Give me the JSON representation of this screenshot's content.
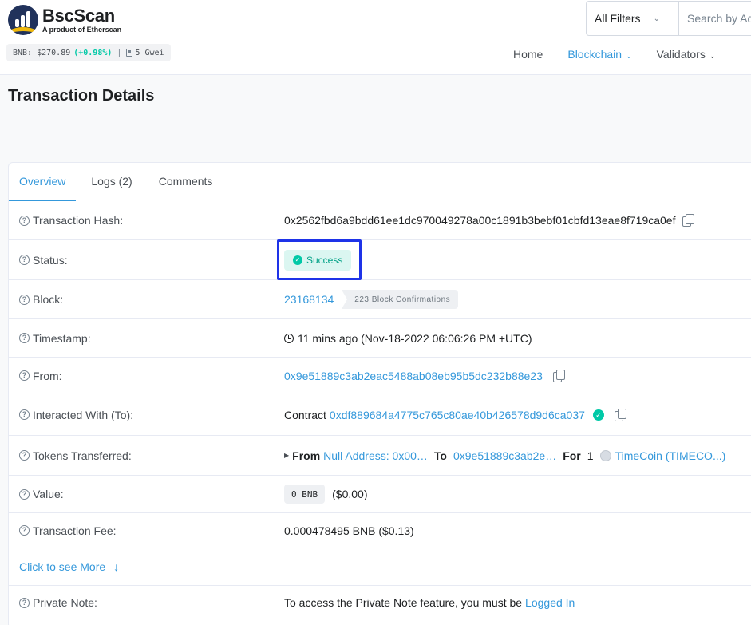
{
  "brand": {
    "name": "BscScan",
    "tagline": "A product of Etherscan"
  },
  "price_bar": {
    "label": "BNB: $270.89",
    "change": "(+0.98%)",
    "separator": "|",
    "gas": "5 Gwei"
  },
  "search": {
    "filter_label": "All Filters",
    "placeholder": "Search by Address / Txn Hash / Block / Token"
  },
  "nav": {
    "home": "Home",
    "blockchain": "Blockchain",
    "validators": "Validators"
  },
  "page": {
    "title": "Transaction Details"
  },
  "tabs": {
    "overview": "Overview",
    "logs": "Logs (2)",
    "comments": "Comments"
  },
  "details": {
    "tx_hash": {
      "label": "Transaction Hash:",
      "value": "0x2562fbd6a9bdd61ee1dc970049278a00c1891b3bebf01cbfd13eae8f719ca0ef"
    },
    "status": {
      "label": "Status:",
      "value": "Success"
    },
    "block": {
      "label": "Block:",
      "value": "23168134",
      "confirmations": "223 Block Confirmations"
    },
    "timestamp": {
      "label": "Timestamp:",
      "value": "11 mins ago (Nov-18-2022 06:06:26 PM +UTC)"
    },
    "from": {
      "label": "From:",
      "value": "0x9e51889c3ab2eac5488ab08eb95b5dc232b88e23"
    },
    "interacted": {
      "label": "Interacted With (To):",
      "prefix": "Contract",
      "value": "0xdf889684a4775c765c80ae40b426578d9d6ca037"
    },
    "tokens": {
      "label": "Tokens Transferred:",
      "from_label": "From",
      "from_value": "Null Address: 0x00…",
      "to_label": "To",
      "to_value": "0x9e51889c3ab2e…",
      "for_label": "For",
      "amount": "1",
      "token": "TimeCoin (TIMECO...)"
    },
    "value": {
      "label": "Value:",
      "amount": "0 BNB",
      "usd": "($0.00)"
    },
    "fee": {
      "label": "Transaction Fee:",
      "value": "0.000478495 BNB ($0.13)"
    },
    "more": {
      "label": "Click to see More"
    },
    "private_note": {
      "label": "Private Note:",
      "text": "To access the Private Note feature, you must be",
      "link": "Logged In"
    }
  },
  "colors": {
    "accent": "#3498db",
    "success": "#00c9a7",
    "highlight": "#1e33e8",
    "brand_dark": "#21325b",
    "brand_gold": "#f0b90b"
  },
  "icons": [
    "bscscan-logo",
    "gas-pump-icon",
    "chevron-down-icon",
    "help-circle-icon",
    "copy-icon",
    "check-circle-icon",
    "clock-icon",
    "caret-right-icon",
    "token-icon",
    "arrow-down-icon"
  ]
}
